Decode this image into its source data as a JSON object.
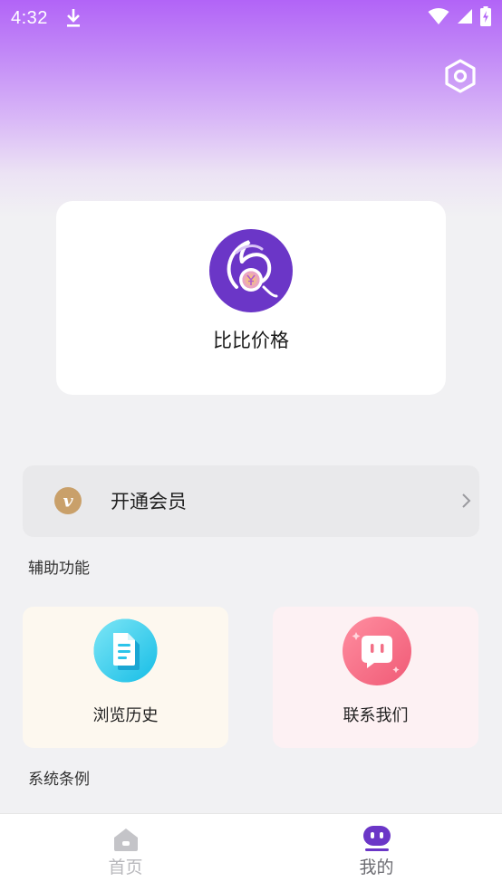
{
  "status_bar": {
    "time": "4:32"
  },
  "profile": {
    "app_name": "比比价格"
  },
  "membership": {
    "label": "开通会员",
    "badge_letter": "v",
    "icon": "vip-badge-icon"
  },
  "sections": {
    "assist_title": "辅助功能",
    "terms_title": "系统条例"
  },
  "features": [
    {
      "label": "浏览历史",
      "icon": "document-icon"
    },
    {
      "label": "联系我们",
      "icon": "chat-icon"
    }
  ],
  "bottom_nav": [
    {
      "label": "首页",
      "icon": "home-icon",
      "active": false
    },
    {
      "label": "我的",
      "icon": "profile-face-icon",
      "active": true
    }
  ],
  "colors": {
    "brand_purple": "#6b36c7",
    "header_purple": "#b264f7",
    "vip_gold": "#c9a06a",
    "history_cyan": "#3ad3f0",
    "contact_pink": "#f36f86"
  }
}
